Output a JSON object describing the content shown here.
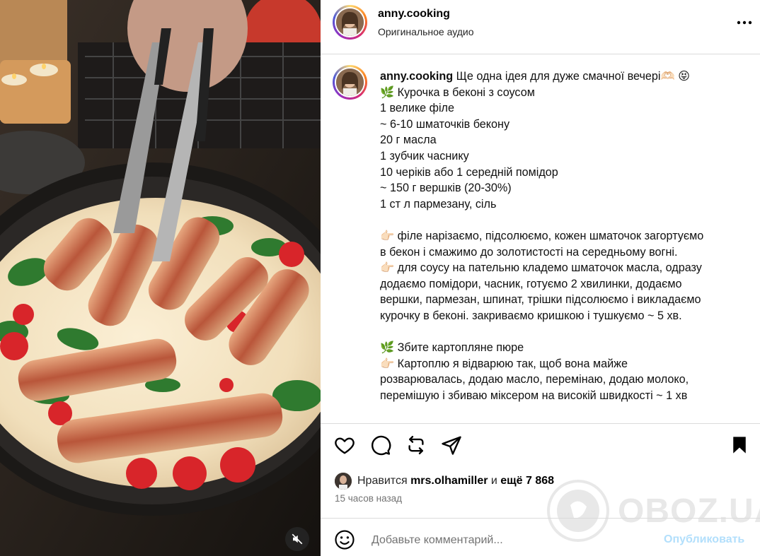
{
  "post": {
    "username": "anny.cooking",
    "audio": "Оригинальное аудио",
    "caption_lines": [
      "Ще одна ідея для дуже смачної вечері🫶🏻 😝",
      "🌿 Курочка в беконі з соусом",
      "1 велике філе",
      "~ 6-10 шматочків бекону",
      "20 г масла",
      "1 зубчик часнику",
      "10 черіків або 1 середній помідор",
      "~ 150 г вершків (20-30%)",
      "1 ст л пармезану, сіль",
      "",
      "👉🏻 філе нарізаємо, підсолюємо, кожен шматочок загортуємо",
      "в бекон і смажимо до золотистості на середньому вогні.",
      "👉🏻 для соусу на пательню кладемо шматочок масла, одразу",
      "додаємо помідори, часник, готуємо 2 хвилинки, додаємо",
      "вершки, пармезан, шпинат, трішки підсолюємо і викладаємо",
      "курочку в беконі. закриваємо кришкою і тушкуємо ~ 5 хв.",
      "",
      "🌿 Збите картопляне пюре",
      "👉🏻 Картоплю я відварюю так, щоб вона майже",
      "розварювалась, додаю масло, перемінаю, додаю молоко,",
      "перемішую і збиваю міксером на високій швидкості ~ 1 хв"
    ]
  },
  "likes": {
    "prefix": "Нравится",
    "user": "mrs.olhamiller",
    "middle": "и",
    "count": "ещё 7 868"
  },
  "time_ago": "15 часов назад",
  "comment": {
    "placeholder": "Добавьте комментарий...",
    "publish": "Опубликовать"
  },
  "watermark": "OBOZ.UA",
  "icons": {
    "header_more": "more-horizontal-icon",
    "like": "heart-icon",
    "comment": "comment-icon",
    "repost": "repost-icon",
    "share": "send-icon",
    "save": "bookmark-icon",
    "emoji": "emoji-icon",
    "mute": "speaker-muted-icon"
  }
}
